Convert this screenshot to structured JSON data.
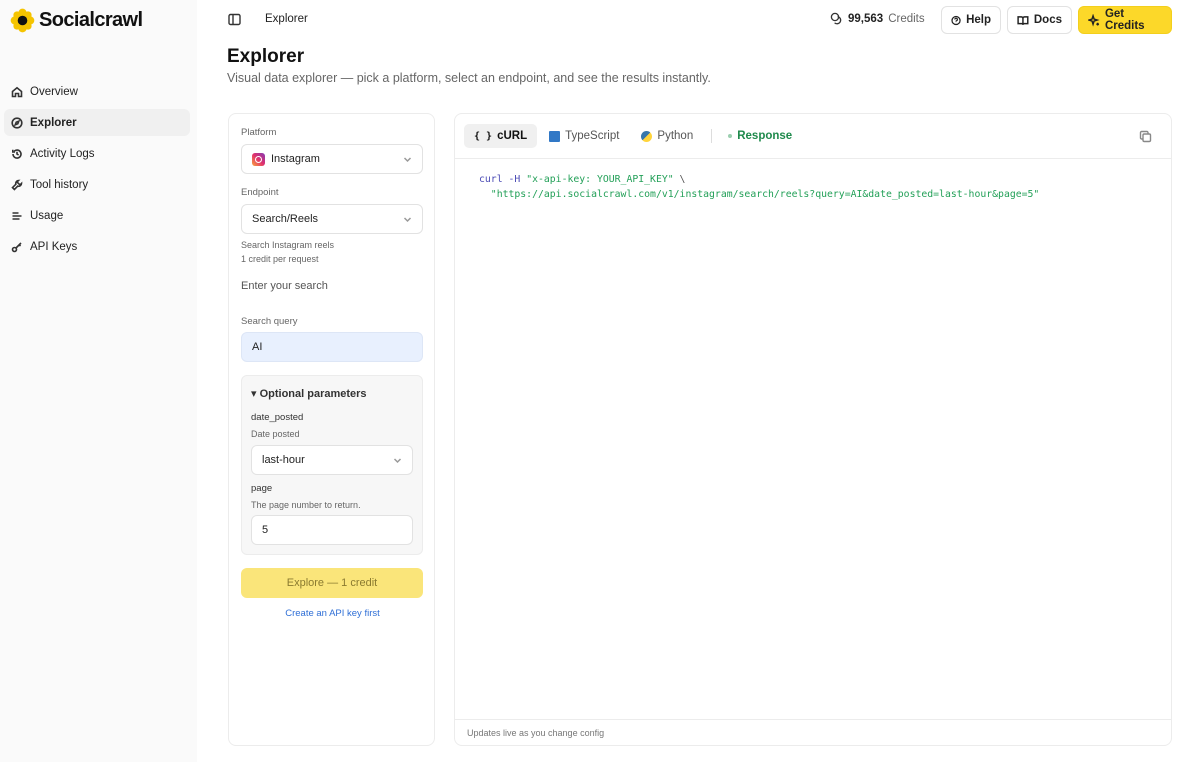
{
  "brand": {
    "name": "Socialcrawl"
  },
  "sidebar": {
    "items": [
      {
        "label": "Overview",
        "icon": "home-icon"
      },
      {
        "label": "Explorer",
        "icon": "compass-icon"
      },
      {
        "label": "Activity Logs",
        "icon": "history-icon"
      },
      {
        "label": "Tool history",
        "icon": "wrench-icon"
      },
      {
        "label": "Usage",
        "icon": "list-icon"
      },
      {
        "label": "API Keys",
        "icon": "key-icon"
      }
    ]
  },
  "header": {
    "breadcrumb": "Explorer",
    "credits_value": "99,563",
    "credits_label": "Credits",
    "help_label": "Help",
    "docs_label": "Docs",
    "get_credits_label": "Get Credits"
  },
  "page": {
    "title": "Explorer",
    "subtitle": "Visual data explorer — pick a platform, select an endpoint, and see the results instantly."
  },
  "config": {
    "platform_label": "Platform",
    "platform_value": "Instagram",
    "endpoint_label": "Endpoint",
    "endpoint_value": "Search/Reels",
    "endpoint_desc": "Search Instagram reels",
    "endpoint_cost": "1 credit per request",
    "enter_search": "Enter your search",
    "query_label": "Search query",
    "query_value": "AI",
    "optional_label": "▾ Optional parameters",
    "date_key": "date_posted",
    "date_desc": "Date posted",
    "date_value": "last-hour",
    "page_key": "page",
    "page_desc": "The page number to return.",
    "page_value": "5",
    "explore_label": "Explore — 1 credit",
    "api_link": "Create an API key first"
  },
  "code": {
    "tabs": {
      "curl_glyph": "{ }",
      "curl": "cURL",
      "typescript": "TypeScript",
      "python": "Python",
      "response": "Response"
    },
    "line1_cmd": "curl -H ",
    "line1_header": "\"x-api-key: YOUR_API_KEY\"",
    "line1_end": " \\",
    "line2_url": "  \"https://api.socialcrawl.com/v1/instagram/search/reels?query=AI&date_posted=last-hour&page=5\"",
    "footer": "Updates live as you change config"
  },
  "colors": {
    "accent": "#fcd829",
    "link": "#2f6fd6",
    "response": "#1f8a4c"
  }
}
